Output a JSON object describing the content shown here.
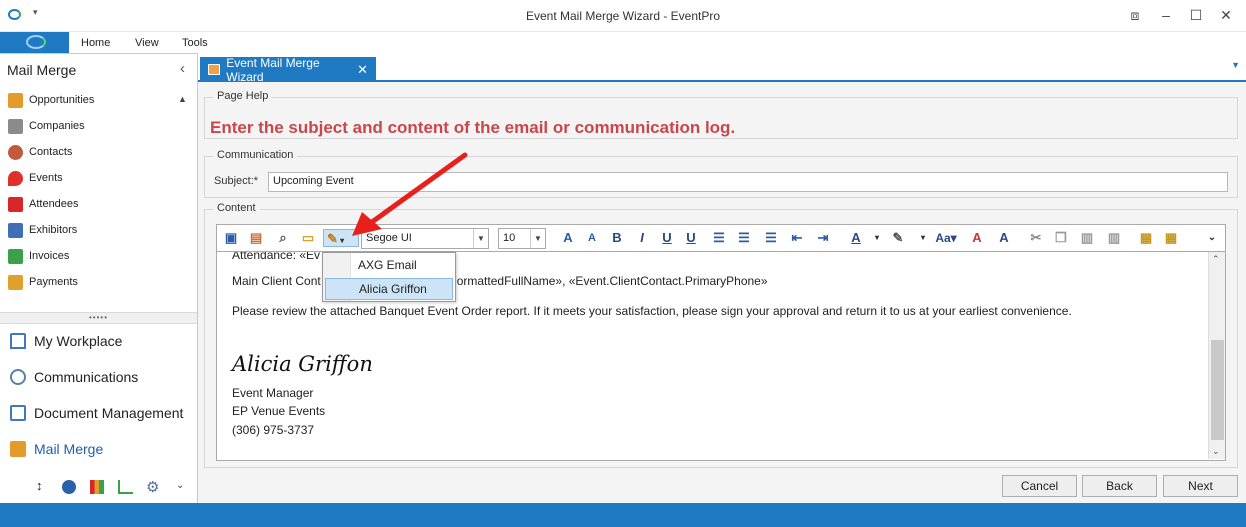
{
  "window": {
    "title": "Event Mail Merge Wizard - EventPro"
  },
  "ribbon": {
    "tabs": [
      "Home",
      "View",
      "Tools"
    ]
  },
  "left_pane": {
    "header": "Mail Merge",
    "items": [
      "Opportunities",
      "Companies",
      "Contacts",
      "Events",
      "Attendees",
      "Exhibitors",
      "Invoices",
      "Payments"
    ],
    "nav": [
      "My Workplace",
      "Communications",
      "Document Management",
      "Mail Merge"
    ]
  },
  "tab": {
    "label": "Event Mail Merge Wizard"
  },
  "page_help": {
    "legend": "Page Help",
    "message": "Enter the subject and content of the email or communication log."
  },
  "communication": {
    "legend": "Communication",
    "subject_label": "Subject:*",
    "subject_value": "Upcoming Event"
  },
  "content": {
    "legend": "Content",
    "font": "Segoe UI",
    "size": "10",
    "lines": {
      "partial_top": "Attendance: «Ev",
      "main_client_a": "Main Client Cont",
      "main_client_b": "ct.FormattedFullName», «Event.ClientContact.PrimaryPhone»",
      "review": "Please review the attached Banquet Event Order report. If it meets your satisfaction, please sign your approval and return it to us at your earliest convenience.",
      "signature": "Alicia Griffon",
      "role": "Event Manager",
      "company": "EP Venue Events",
      "phone": "(306) 975-3737"
    }
  },
  "popup": {
    "items": [
      "AXG Email",
      "Alicia Griffon"
    ],
    "selected": "Alicia Griffon"
  },
  "buttons": {
    "cancel": "Cancel",
    "back": "Back",
    "next": "Next"
  },
  "colors": {
    "accent": "#1f79c3",
    "help_text": "#c9474b",
    "annotation_arrow": "#e8201c"
  }
}
